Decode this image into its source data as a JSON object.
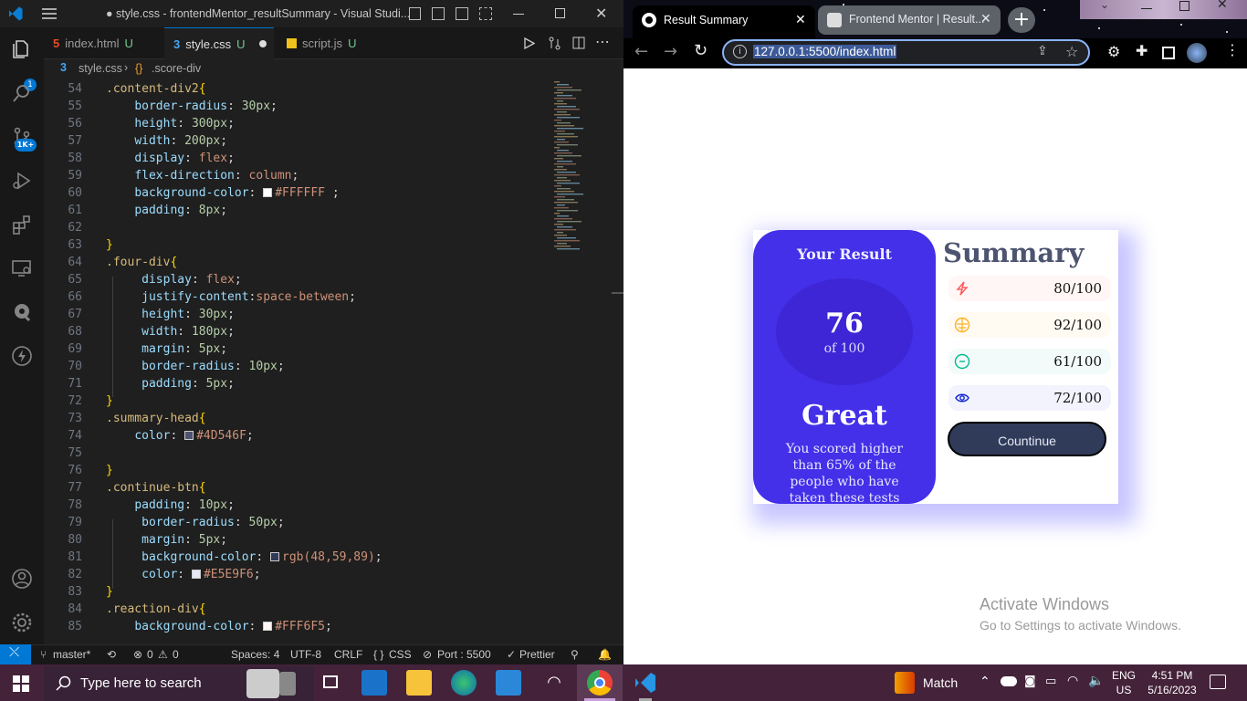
{
  "vscode": {
    "window_title": "● style.css - frontendMentor_resultSummary - Visual Studi...",
    "source_control_badge": "1K+",
    "explorer_badge": "1",
    "tabs": [
      {
        "label": "index.html",
        "status": "U",
        "icon": "html-icon"
      },
      {
        "label": "style.css",
        "status": "U",
        "icon": "css-icon",
        "active": true
      },
      {
        "label": "script.js",
        "status": "U",
        "icon": "js-icon"
      }
    ],
    "breadcrumb": {
      "file": "style.css",
      "symbol": ".score-div"
    },
    "line_numbers": [
      "54",
      "55",
      "56",
      "57",
      "58",
      "59",
      "60",
      "61",
      "62",
      "63",
      "64",
      "65",
      "66",
      "67",
      "68",
      "69",
      "70",
      "71",
      "72",
      "73",
      "74",
      "75",
      "76",
      "77",
      "78",
      "79",
      "80",
      "81",
      "82",
      "83",
      "84",
      "85"
    ],
    "code_lines": [
      ".content-div2{",
      "    border-radius: 30px;",
      "    height: 300px;",
      "    width: 200px;",
      "    display: flex;",
      "    flex-direction: column;",
      "    background-color: #FFFFFF ;",
      "    padding: 8px;",
      "",
      "}",
      ".four-div{",
      "     display: flex;",
      "     justify-content:space-between;",
      "     height: 30px;",
      "     width: 180px;",
      "     margin: 5px;",
      "     border-radius: 10px;",
      "     padding: 5px;",
      "}",
      ".summary-head{",
      "    color: #4D546F;",
      "",
      "}",
      ".continue-btn{",
      "    padding: 10px;",
      "     border-radius: 50px;",
      "     margin: 5px;",
      "     background-color: rgb(48,59,89);",
      "     color: #E5E9F6;",
      "}",
      ".reaction-div{",
      "    background-color: #FFF6F5;"
    ],
    "status_bar": {
      "branch": "master*",
      "errors": "0",
      "warnings": "0",
      "spaces": "Spaces: 4",
      "encoding": "UTF-8",
      "eol": "CRLF",
      "language": "CSS",
      "port": "Port : 5500",
      "formatter": "Prettier"
    }
  },
  "chrome": {
    "tabs": [
      {
        "label": "Result Summary",
        "active": true
      },
      {
        "label": "Frontend Mentor | Result..."
      }
    ],
    "url": "127.0.0.1:5500/index.html"
  },
  "page": {
    "result_title": "Your Result",
    "score": "76",
    "score_total": "of 100",
    "rating": "Great",
    "description": "You scored higher than 65% of the people who have taken these tests",
    "summary_title": "Summary",
    "categories": [
      {
        "icon": "lightning-icon",
        "value": "80/100",
        "bg": "#FFF6F5",
        "color": "#FF5757"
      },
      {
        "icon": "brain-icon",
        "value": "92/100",
        "bg": "#FFFBF2",
        "color": "#FFB01F"
      },
      {
        "icon": "chat-icon",
        "value": "61/100",
        "bg": "#F2FBFA",
        "color": "#00BB8F"
      },
      {
        "icon": "eye-icon",
        "value": "72/100",
        "bg": "#F3F3FD",
        "color": "#1125D4"
      }
    ],
    "button_label": "Countinue",
    "colors": {
      "result_bg": "#4330E8",
      "circle_bg": "#3E26D6",
      "button_bg": "#303B59",
      "summary_head": "#4D546F"
    }
  },
  "watermark": {
    "line1": "Activate Windows",
    "line2": "Go to Settings to activate Windows."
  },
  "taskbar": {
    "search_placeholder": "Type here to search",
    "widget_label": "Match",
    "language": "ENG",
    "region": "US",
    "time": "4:51 PM",
    "date": "5/16/2023"
  }
}
